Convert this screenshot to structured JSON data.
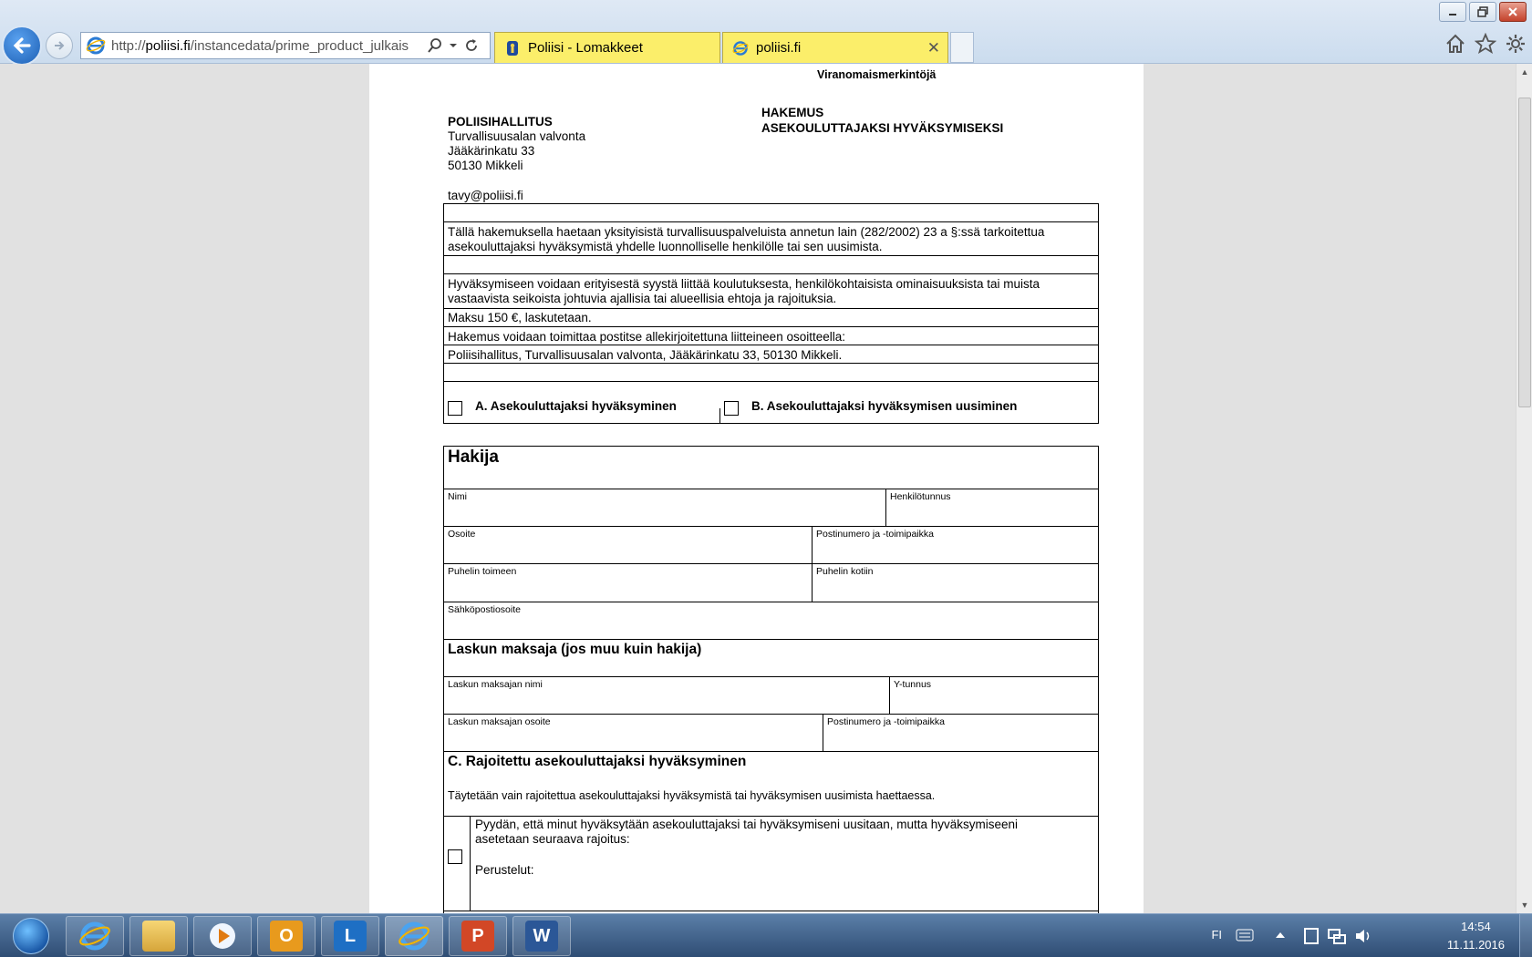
{
  "browser": {
    "url_prefix": "http://",
    "url_domain": "poliisi.fi",
    "url_path": "/instancedata/prime_product_julkais",
    "tabs": [
      {
        "label": "Poliisi - Lomakkeet"
      },
      {
        "label": "poliisi.fi"
      }
    ]
  },
  "form": {
    "authority_note": "Viranomaismerkintöjä",
    "sender_org": "POLIISIHALLITUS",
    "sender_lines": [
      "Turvallisuusalan valvonta",
      "Jääkärinkatu 33",
      "50130 Mikkeli"
    ],
    "sender_email": "tavy@poliisi.fi",
    "doc_type": "HAKEMUS",
    "doc_title": "ASEKOULUTTAJAKSI HYVÄKSYMISEKSI",
    "intro_lines": [
      "Tällä hakemuksella haetaan yksityisistä turvallisuuspalveluista annetun lain (282/2002) 23 a §:ssä tarkoitettua",
      "asekouluttajaksi hyväksymistä yhdelle luonnolliselle henkilölle tai sen uusimista."
    ],
    "conditions_lines": [
      "Hyväksymiseen voidaan erityisestä syystä liittää koulutuksesta, henkilökohtaisista ominaisuuksista tai muista",
      "vastaavista seikoista johtuvia ajallisia tai alueellisia ehtoja ja rajoituksia."
    ],
    "fee": "Maksu 150 €, laskutetaan.",
    "delivery": "Hakemus voidaan toimittaa postitse allekirjoitettuna liitteineen osoitteella:",
    "address": "Poliisihallitus, Turvallisuusalan valvonta, Jääkärinkatu 33, 50130 Mikkeli.",
    "option_a": "A. Asekouluttajaksi hyväksyminen",
    "option_b": "B. Asekouluttajaksi hyväksymisen uusiminen",
    "applicant_heading": "Hakija",
    "fields": {
      "name": "Nimi",
      "ssn": "Henkilötunnus",
      "address": "Osoite",
      "postal": "Postinumero ja -toimipaikka",
      "phone_work": "Puhelin toimeen",
      "phone_home": "Puhelin kotiin",
      "email": "Sähköpostiosoite"
    },
    "payer_heading": "Laskun maksaja (jos muu kuin hakija)",
    "payer_fields": {
      "name": "Laskun maksajan nimi",
      "business_id": "Y-tunnus",
      "address": "Laskun maksajan osoite",
      "postal": "Postinumero ja -toimipaikka"
    },
    "restricted_heading": "C. Rajoitettu asekouluttajaksi hyväksyminen",
    "restricted_note": "Täytetään vain rajoitettua asekouluttajaksi hyväksymistä tai  hyväksymisen uusimista haettaessa.",
    "restricted_request_lines": [
      "Pyydän, että minut hyväksytään asekouluttajaksi tai hyväksymiseni uusitaan, mutta hyväksymiseeni",
      "asetetaan seuraava rajoitus:"
    ],
    "grounds_label": "Perustelut:"
  },
  "taskbar": {
    "language": "FI",
    "time": "14:54",
    "date": "11.11.2016"
  },
  "colors": {
    "tab_active": "#fbee6a",
    "ie_blue": "#1c5fb4"
  }
}
